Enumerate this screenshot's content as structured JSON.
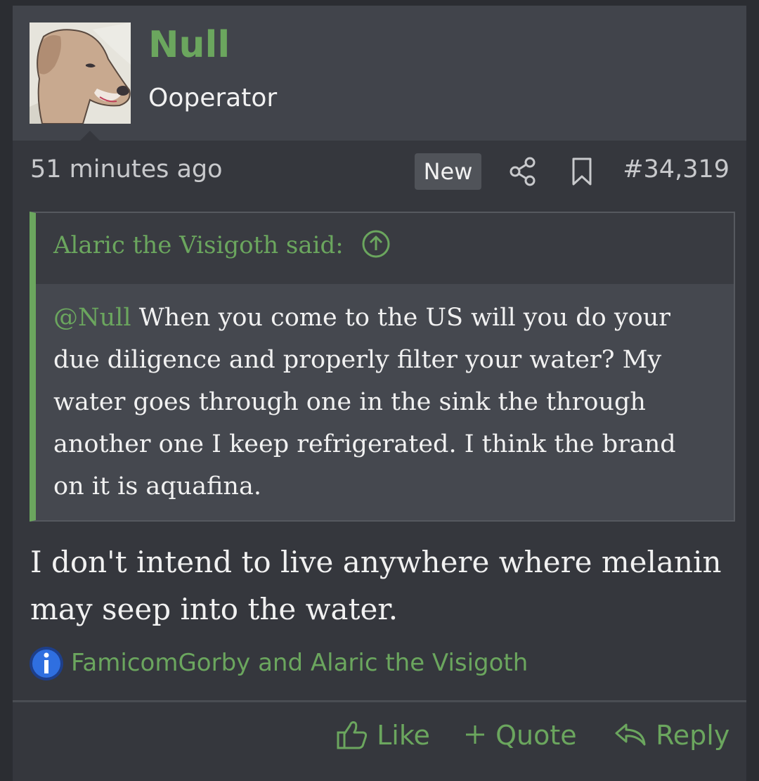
{
  "user": {
    "name": "Null",
    "title": "Ooperator"
  },
  "meta": {
    "time": "51 minutes ago",
    "new_badge": "New",
    "post_number": "#34,319"
  },
  "quote": {
    "author_said": "Alaric the Visigoth said:",
    "mention": "@Null",
    "text": " When you come to the US will you do your due diligence and properly filter your water? My water goes through one in the sink the through another one I keep refrigerated. I think the brand on it is aquafina."
  },
  "message": "I don't intend to live anywhere where melanin may seep into the water.",
  "reactions": {
    "users": "FamicomGorby and Alaric the Visigoth"
  },
  "actions": {
    "like": "Like",
    "quote": "Quote",
    "reply": "Reply"
  },
  "colors": {
    "accent": "#6ba65e",
    "background": "#2b2d32",
    "post_bg": "#35373d",
    "header_bg": "#41444b"
  },
  "icons": [
    "dog-avatar",
    "share-icon",
    "bookmark-icon",
    "arrow-up-circle-icon",
    "info-icon",
    "thumbs-up-icon",
    "plus-icon",
    "reply-icon"
  ]
}
